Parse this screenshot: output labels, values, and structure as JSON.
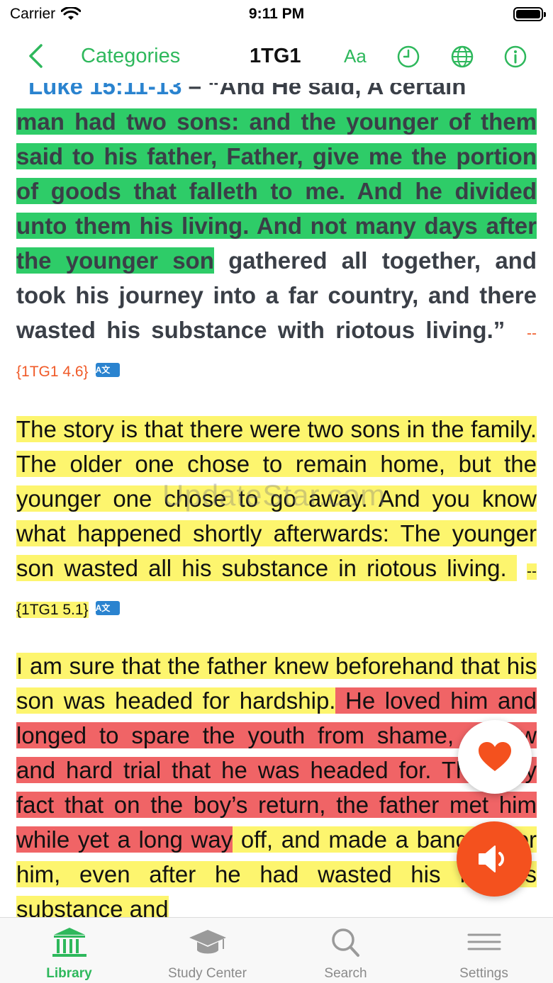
{
  "status_bar": {
    "carrier": "Carrier",
    "time": "9:11 PM"
  },
  "nav": {
    "back_label": "Categories",
    "title": "1TG1",
    "font_label": "Aa"
  },
  "content": {
    "p1_partial_ref": "Luke 15:11-13",
    "p1_partial_rest": " – “And He said, A certain",
    "p1_green": "man had two sons: and the younger of them said to his father, Father, give me the portion of goods that falleth to me. And he divided unto them his living. And not many days after the younger son",
    "p1_rest": " gathered all together, and took his journey into a far country, and there wasted his substance with riotous living.”",
    "p1_ref": "--{1TG1 4.6}",
    "p2_yellow": " The story is that there were two sons in the family. The older one chose to remain home, but the younger one chose to go away.  And you know what happened shortly afterwards: The younger son wasted all his substance in riotous living.",
    "p2_ref": "--{1TG1 5.1}",
    "p3_yellow_a": " I am sure that the father knew beforehand that his son was headed for hardship.",
    "p3_red": " He loved him and longed to spare the youth from shame, sorrow and hard trial that he was headed for. The very fact that on the boy’s return, the father met him while yet a long way",
    "p3_yellow_b": " off, and made a banquet for him, even after he had wasted his father’s substance and",
    "translate_badge": "A文",
    "watermark": "UpdateStar.com"
  },
  "tabs": [
    {
      "label": "Library",
      "icon": "library-icon",
      "active": true
    },
    {
      "label": "Study Center",
      "icon": "graduation-cap-icon",
      "active": false
    },
    {
      "label": "Search",
      "icon": "search-icon",
      "active": false
    },
    {
      "label": "Settings",
      "icon": "menu-lines-icon",
      "active": false
    }
  ],
  "colors": {
    "accent_green": "#2eb85c",
    "highlight_green": "#2ecc68",
    "highlight_yellow": "#fdf56e",
    "highlight_red": "#f06466",
    "reference_orange": "#f05a28",
    "link_blue": "#2a83cf",
    "audio_button": "#f4511e"
  }
}
